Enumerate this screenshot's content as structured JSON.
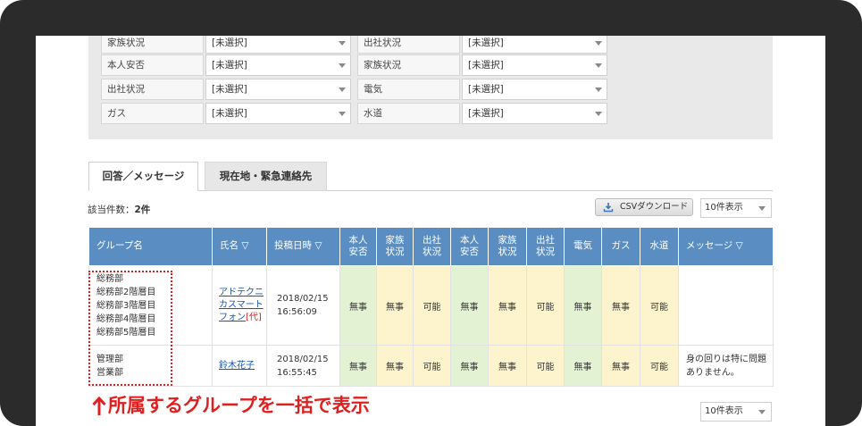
{
  "filters": {
    "rows": [
      {
        "left": {
          "label": "家族状況",
          "value": "[未選択]"
        },
        "right": {
          "label": "出社状況",
          "value": "[未選択]"
        }
      },
      {
        "left": {
          "label": "本人安否",
          "value": "[未選択]"
        },
        "right": {
          "label": "家族状況",
          "value": "[未選択]"
        }
      },
      {
        "left": {
          "label": "出社状況",
          "value": "[未選択]"
        },
        "right": {
          "label": "電気",
          "value": "[未選択]"
        }
      },
      {
        "left": {
          "label": "ガス",
          "value": "[未選択]"
        },
        "right": {
          "label": "水道",
          "value": "[未選択]"
        }
      }
    ]
  },
  "tabs": {
    "active": "回答／メッセージ",
    "inactive": "現在地・緊急連絡先"
  },
  "count": {
    "label": "該当件数：",
    "value": "2件"
  },
  "toolbar": {
    "csv_label": "CSVダウンロード",
    "per_page_top": "10件表示",
    "per_page_bottom": "10件表示"
  },
  "table": {
    "headers": {
      "group": "グループ名",
      "name": "氏名 ▽",
      "date": "投稿日時 ▽",
      "col1": "本人\n安否",
      "col2": "家族\n状況",
      "col3": "出社\n状況",
      "col4": "本人\n安否",
      "col5": "家族\n状況",
      "col6": "出社\n状況",
      "col7": "電気",
      "col8": "ガス",
      "col9": "水道",
      "message": "メッセージ ▽"
    },
    "rows": [
      {
        "groups": [
          "総務部",
          "総務部2階層目",
          "総務部3階層目",
          "総務部4階層目",
          "総務部5階層目"
        ],
        "name": "アドテクニカスマートフォン",
        "proxy_tag": "[代]",
        "date": "2018/02/15",
        "time": "16:56:09",
        "c1": "無事",
        "c2": "無事",
        "c3": "可能",
        "c4": "無事",
        "c5": "無事",
        "c6": "可能",
        "c7": "無事",
        "c8": "無事",
        "c9": "可能",
        "message": ""
      },
      {
        "groups": [
          "管理部",
          "営業部"
        ],
        "name": "鈴木花子",
        "proxy_tag": "",
        "date": "2018/02/15",
        "time": "16:55:45",
        "c1": "無事",
        "c2": "無事",
        "c3": "可能",
        "c4": "無事",
        "c5": "無事",
        "c6": "可能",
        "c7": "無事",
        "c8": "無事",
        "c9": "可能",
        "message": "身の回りは特に問題ありません。"
      }
    ]
  },
  "annotation": {
    "caption": "所属するグループを一括で表示",
    "color": "#e02020"
  },
  "colors": {
    "header": "#5a8ec2",
    "green_cell": "#e4f2d4",
    "yellow_cell": "#fdf3cc"
  },
  "icons": {
    "arrow": "arrow-up-icon",
    "download": "download-icon",
    "dropdown": "chevron-down-icon"
  }
}
